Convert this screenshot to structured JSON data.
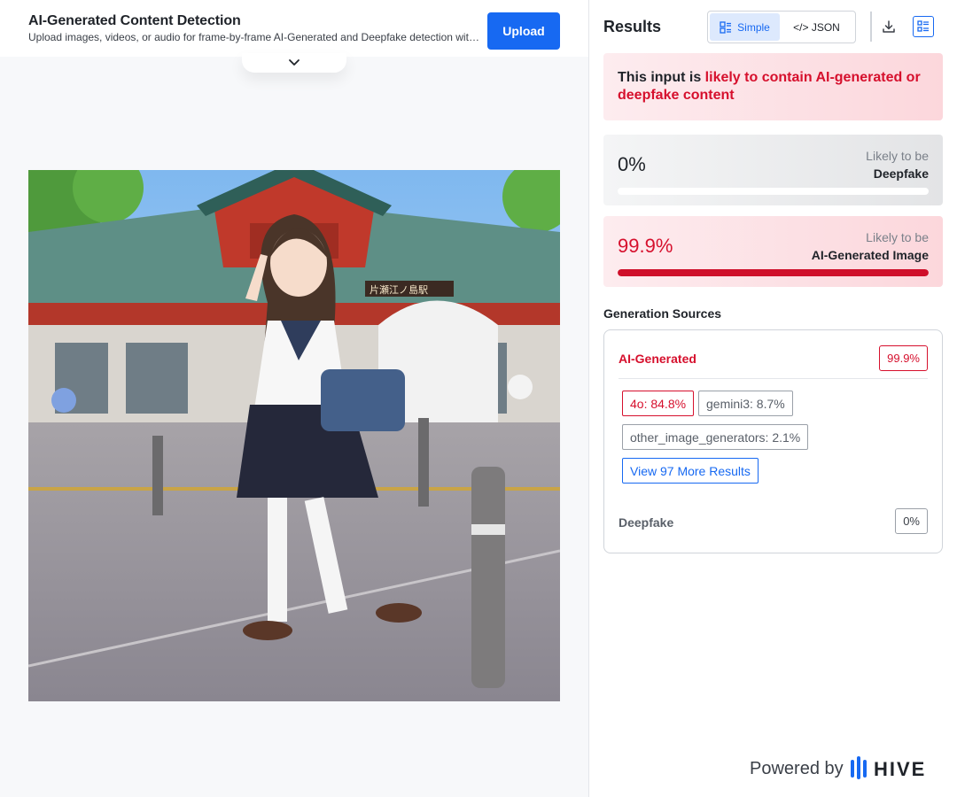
{
  "header": {
    "title": "AI-Generated Content Detection",
    "subtitle": "Upload images, videos, or audio for frame-by-frame AI-Generated and Deepfake detection with Hive's industry-leading models.",
    "upload_label": "Upload",
    "expand_icon": "chevron-down-icon"
  },
  "preview": {
    "station_sign": "片瀬江ノ島駅"
  },
  "results": {
    "title": "Results",
    "view_toggle": {
      "simple_label": "Simple",
      "json_label": "</> JSON",
      "selected": "Simple"
    },
    "toolbar_icons": [
      "download-icon",
      "list-view-icon"
    ],
    "summary": {
      "prefix": "This input is ",
      "highlight": "likely to contain AI-generated or deepfake content"
    },
    "scores": [
      {
        "value": "0%",
        "fraction": 0.0,
        "line1": "Likely to be",
        "line2": "Deepfake"
      },
      {
        "value": "99.9%",
        "fraction": 0.999,
        "line1": "Likely to be",
        "line2": "AI-Generated Image"
      }
    ],
    "generation_sources": {
      "title": "Generation Sources",
      "ai_generated_label": "AI-Generated",
      "ai_generated_value": "99.9%",
      "chips": [
        "4o: 84.8%",
        "gemini3: 8.7%",
        "other_image_generators: 2.1%"
      ],
      "more_results_label": "View 97 More Results",
      "deepfake_label": "Deepfake",
      "deepfake_value": "0%"
    },
    "footer": {
      "powered_by": "Powered by",
      "brand": "HIVE"
    }
  },
  "colors": {
    "accent_blue": "#1769f2",
    "alert_red": "#d6102d"
  }
}
